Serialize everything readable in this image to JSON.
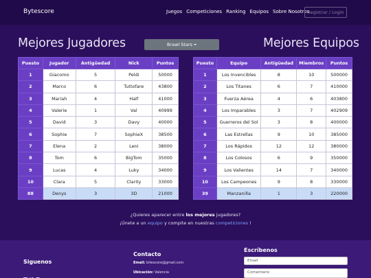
{
  "nav": {
    "brand": "Bytescore",
    "links": [
      "Juegos",
      "Competiciones",
      "Ranking",
      "Equipos",
      "Sobre Nosotros"
    ],
    "login": "Registrar / Login"
  },
  "titles": {
    "players": "Mejores Jugadores",
    "teams": "Mejores Equipos"
  },
  "game_select": {
    "value": "Brawl Stars"
  },
  "players_table": {
    "headers": [
      "Puesto",
      "Jugador",
      "Antigüedad",
      "Nick",
      "Puntos"
    ],
    "rows": [
      [
        "1",
        "Giacomo",
        "5",
        "Peldi",
        "50000"
      ],
      [
        "2",
        "Marco",
        "6",
        "Tuttofare",
        "43800"
      ],
      [
        "3",
        "Mariah",
        "4",
        "Half",
        "41000"
      ],
      [
        "4",
        "Valerie",
        "1",
        "Val",
        "40999"
      ],
      [
        "5",
        "David",
        "3",
        "Davy",
        "40000"
      ],
      [
        "6",
        "Sophie",
        "7",
        "SophieX",
        "38500"
      ],
      [
        "7",
        "Elena",
        "2",
        "Leni",
        "38000"
      ],
      [
        "8",
        "Tom",
        "6",
        "BigTom",
        "35000"
      ],
      [
        "9",
        "Lucas",
        "4",
        "Luky",
        "34000"
      ],
      [
        "10",
        "Clara",
        "5",
        "Clarity",
        "33000"
      ],
      [
        "88",
        "Denys",
        "3",
        "3D",
        "21000"
      ]
    ]
  },
  "teams_table": {
    "headers": [
      "Puesto",
      "Equipo",
      "Antigüedad",
      "Miembros",
      "Puntos"
    ],
    "rows": [
      [
        "1",
        "Los Invencibles",
        "8",
        "10",
        "500000"
      ],
      [
        "2",
        "Los Titanes",
        "6",
        "7",
        "410000"
      ],
      [
        "3",
        "Fuerza Aérea",
        "4",
        "6",
        "403800"
      ],
      [
        "4",
        "Los Imparables",
        "3",
        "7",
        "402909"
      ],
      [
        "5",
        "Guerreros del Sol",
        "3",
        "8",
        "400000"
      ],
      [
        "6",
        "Las Estrellas",
        "9",
        "10",
        "385000"
      ],
      [
        "7",
        "Los Rápidos",
        "12",
        "12",
        "380000"
      ],
      [
        "8",
        "Los Colosos",
        "6",
        "9",
        "350000"
      ],
      [
        "9",
        "Los Valientes",
        "14",
        "7",
        "340000"
      ],
      [
        "10",
        "Los Campeones",
        "9",
        "8",
        "330000"
      ],
      [
        "39",
        "Manzanilla",
        "1",
        "3",
        "220000"
      ]
    ]
  },
  "cta": {
    "line1_a": "¿Quieres aparecer entre ",
    "line1_b": "los mejores",
    "line1_c": " jugadores?",
    "line2_a": "¡Únete a un ",
    "line2_link1": "equipo",
    "line2_b": " y compite en nuestras ",
    "line2_link2": "competiciones",
    "line2_c": " !"
  },
  "footer": {
    "follow_title": "Siguenos",
    "contact_title": "Contacto",
    "email_label": "Email:",
    "email_value": "bitescore@gmail.com",
    "location_label": "Ubicación:",
    "location_value": "Valencia",
    "write_title": "Escríbenos",
    "email_placeholder": "Email",
    "comment_placeholder": "Comentario"
  },
  "colors": {
    "background": "#2b0f5c",
    "navbar": "#200a4a",
    "table_header": "#6a3fc4",
    "highlight_row": "#c9dcf7",
    "link": "#7fa2ff"
  }
}
